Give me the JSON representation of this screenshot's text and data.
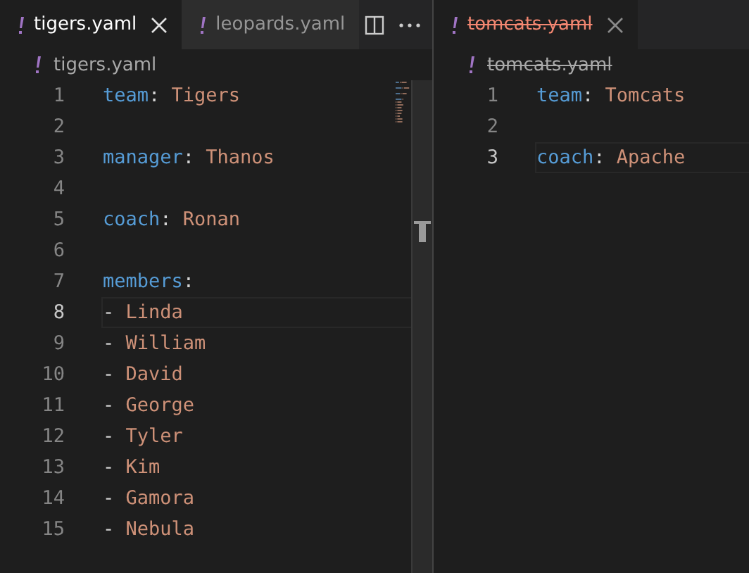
{
  "left_pane": {
    "tabs": [
      {
        "label": "tigers.yaml",
        "selected": true,
        "deleted": false
      },
      {
        "label": "leopards.yaml",
        "selected": false,
        "deleted": false
      }
    ],
    "breadcrumb": {
      "label": "tigers.yaml",
      "deleted": false
    },
    "lines": [
      {
        "number": "1",
        "tokens": [
          {
            "kind": "key",
            "text": "team"
          },
          {
            "kind": "punct",
            "text": ":"
          },
          {
            "kind": "value",
            "text": "Tigers"
          }
        ],
        "current": false
      },
      {
        "number": "2",
        "current": false
      },
      {
        "number": "3",
        "tokens": [
          {
            "kind": "key",
            "text": "manager"
          },
          {
            "kind": "punct",
            "text": ":"
          },
          {
            "kind": "value",
            "text": "Thanos"
          }
        ],
        "current": false
      },
      {
        "number": "4",
        "current": false
      },
      {
        "number": "5",
        "tokens": [
          {
            "kind": "key",
            "text": "coach"
          },
          {
            "kind": "punct",
            "text": ":"
          },
          {
            "kind": "value",
            "text": "Ronan"
          }
        ],
        "current": false
      },
      {
        "number": "6",
        "current": false
      },
      {
        "number": "7",
        "tokens": [
          {
            "kind": "key",
            "text": "members"
          },
          {
            "kind": "punct",
            "text": ":"
          }
        ],
        "current": false
      },
      {
        "number": "8",
        "tokens": [
          {
            "kind": "punct",
            "text": "-"
          },
          {
            "kind": "value",
            "text": "Linda"
          }
        ],
        "current": true
      },
      {
        "number": "9",
        "tokens": [
          {
            "kind": "punct",
            "text": "-"
          },
          {
            "kind": "value",
            "text": "William"
          }
        ],
        "current": false
      },
      {
        "number": "10",
        "tokens": [
          {
            "kind": "punct",
            "text": "-"
          },
          {
            "kind": "value",
            "text": "David"
          }
        ],
        "current": false
      },
      {
        "number": "11",
        "tokens": [
          {
            "kind": "punct",
            "text": "-"
          },
          {
            "kind": "value",
            "text": "George"
          }
        ],
        "current": false
      },
      {
        "number": "12",
        "tokens": [
          {
            "kind": "punct",
            "text": "-"
          },
          {
            "kind": "value",
            "text": "Tyler"
          }
        ],
        "current": false
      },
      {
        "number": "13",
        "tokens": [
          {
            "kind": "punct",
            "text": "-"
          },
          {
            "kind": "value",
            "text": "Kim"
          }
        ],
        "current": false
      },
      {
        "number": "14",
        "tokens": [
          {
            "kind": "punct",
            "text": "-"
          },
          {
            "kind": "value",
            "text": "Gamora"
          }
        ],
        "current": false
      },
      {
        "number": "15",
        "tokens": [
          {
            "kind": "punct",
            "text": "-"
          },
          {
            "kind": "value",
            "text": "Nebula"
          }
        ],
        "current": false
      }
    ]
  },
  "right_pane": {
    "tabs": [
      {
        "label": "tomcats.yaml",
        "selected": true,
        "deleted": true
      }
    ],
    "breadcrumb": {
      "label": "tomcats.yaml",
      "deleted": true
    },
    "lines": [
      {
        "number": "1",
        "tokens": [
          {
            "kind": "key",
            "text": "team"
          },
          {
            "kind": "punct",
            "text": ":"
          },
          {
            "kind": "value",
            "text": "Tomcats"
          }
        ],
        "current": false
      },
      {
        "number": "2",
        "current": false
      },
      {
        "number": "3",
        "tokens": [
          {
            "kind": "key",
            "text": "coach"
          },
          {
            "kind": "punct",
            "text": ":"
          },
          {
            "kind": "value",
            "text": "Apache"
          }
        ],
        "current": true
      }
    ]
  }
}
